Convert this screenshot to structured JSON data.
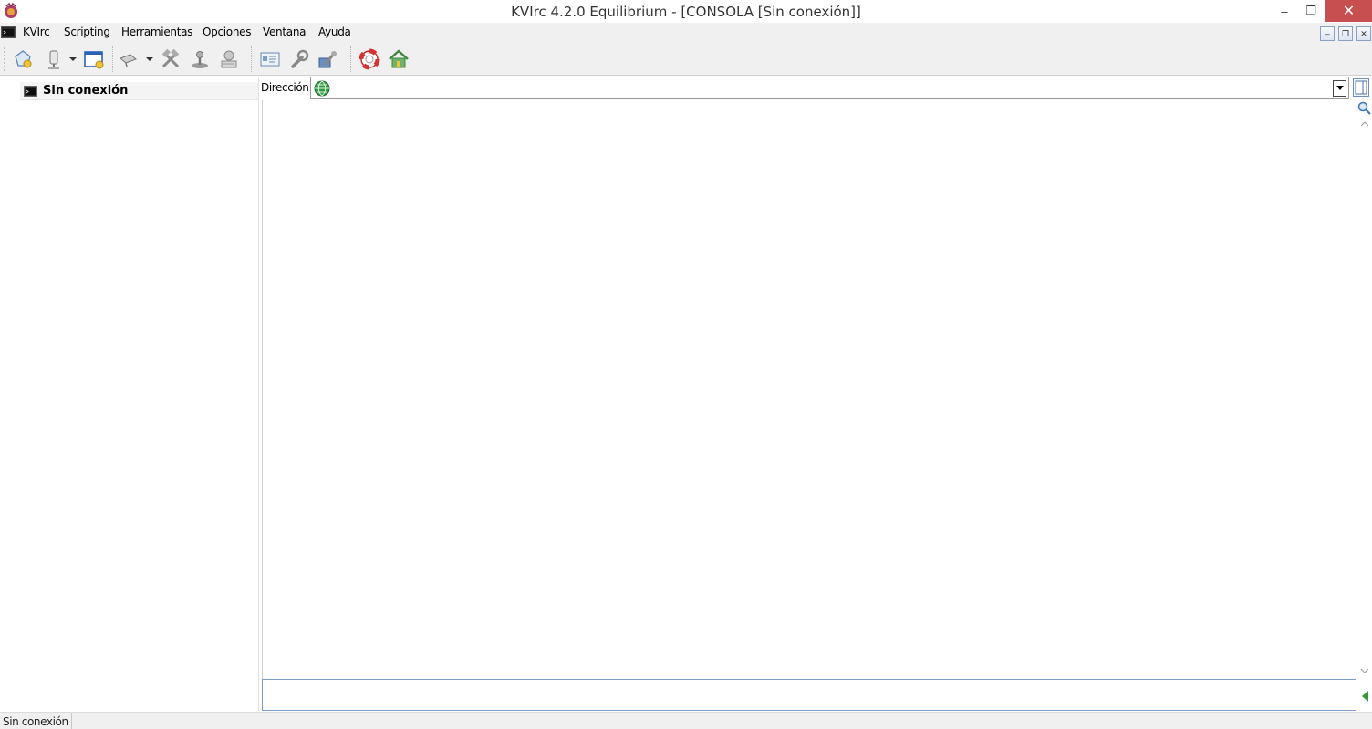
{
  "window": {
    "title": "KVIrc 4.2.0 Equilibrium - [CONSOLA [Sin conexión]]",
    "controls": {
      "minimize": "–",
      "maximize": "❐",
      "close": "✕"
    }
  },
  "menubar": {
    "items": [
      "KVIrc",
      "Scripting",
      "Herramientas",
      "Opciones",
      "Ventana",
      "Ayuda"
    ],
    "mdi_controls": {
      "minimize": "–",
      "restore": "❐",
      "close": "✕"
    }
  },
  "toolbar": {
    "icons": [
      "new-connection-icon",
      "connect-icon",
      "new-window-icon",
      "actions-icon",
      "tools-icon",
      "joystick-icon",
      "computer-icon",
      "identity-icon",
      "options-wrench-icon",
      "theme-icon",
      "help-lifebuoy-icon",
      "home-icon"
    ]
  },
  "tree": {
    "items": [
      {
        "label": "Sin conexión",
        "icon": "console-icon"
      }
    ]
  },
  "address": {
    "label": "Dirección:",
    "value": "",
    "placeholder": ""
  },
  "input": {
    "value": ""
  },
  "statusbar": {
    "text": "Sin conexión"
  },
  "colors": {
    "close_button": "#c74f4f",
    "chrome": "#f0f0f0",
    "input_border": "#7a9cc8"
  }
}
